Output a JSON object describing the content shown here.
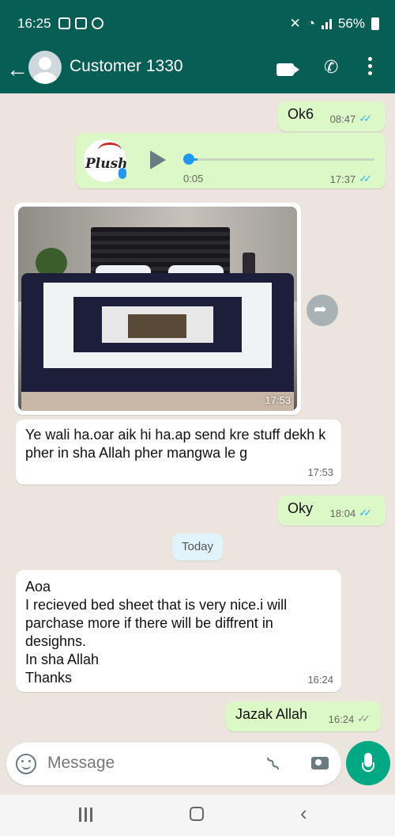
{
  "status": {
    "time": "16:25",
    "battery": "56%"
  },
  "header": {
    "title": "Customer 1330"
  },
  "messages": {
    "m1": {
      "text": "Ok6",
      "time": "08:47"
    },
    "voice": {
      "duration": "0:05",
      "time": "17:37",
      "logo_text": "Plush",
      "progress": 0.05
    },
    "photo": {
      "time": "17:53"
    },
    "m3": {
      "text": "Ye wali ha.oar aik hi ha.ap send kre stuff dekh k pher in sha Allah pher mangwa le g",
      "time": "17:53"
    },
    "m4": {
      "text": "Oky",
      "time": "18:04"
    },
    "m5": {
      "text": "Aoa\nI recieved bed sheet that is very nice.i will parchase more if there will be diffrent in desighns.\nIn sha Allah\nThanks",
      "time": "16:24"
    },
    "m6": {
      "text": "Jazak Allah",
      "time": "16:24"
    }
  },
  "date_chip": "Today",
  "composer": {
    "placeholder": "Message"
  }
}
